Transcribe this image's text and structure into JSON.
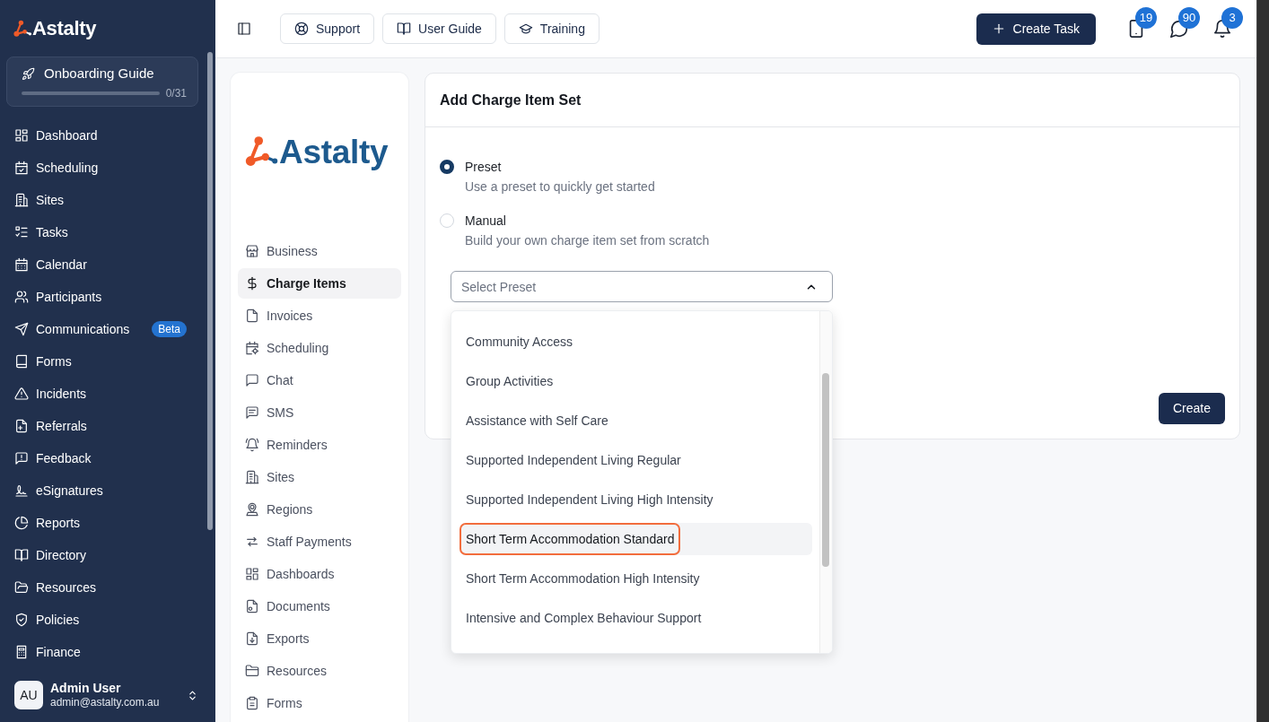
{
  "sidebar": {
    "logo_text": "Astalty",
    "onboarding": {
      "title": "Onboarding Guide",
      "level": 0,
      "count": "0/31"
    },
    "items": [
      {
        "label": "Dashboard",
        "selected": false
      },
      {
        "label": "Scheduling",
        "selected": false
      },
      {
        "label": "Sites",
        "selected": false
      },
      {
        "label": "Tasks",
        "selected": false
      },
      {
        "label": "Calendar",
        "selected": false
      },
      {
        "label": "Participants",
        "selected": false
      },
      {
        "label": "Communications",
        "selected": false,
        "badge": "Beta"
      },
      {
        "label": "Forms",
        "selected": false
      },
      {
        "label": "Incidents",
        "selected": false
      },
      {
        "label": "Referrals",
        "selected": false
      },
      {
        "label": "Feedback",
        "selected": false
      },
      {
        "label": "eSignatures",
        "selected": false
      },
      {
        "label": "Reports",
        "selected": false
      },
      {
        "label": "Directory",
        "selected": false
      },
      {
        "label": "Resources",
        "selected": false
      },
      {
        "label": "Policies",
        "selected": false
      },
      {
        "label": "Finance",
        "selected": false
      }
    ],
    "user": {
      "initials": "AU",
      "name": "Admin User",
      "email": "admin@astalty.com.au"
    }
  },
  "topbar": {
    "links": [
      {
        "label": "Support"
      },
      {
        "label": "User Guide"
      },
      {
        "label": "Training"
      }
    ],
    "create_button": "Create Task",
    "notifications": [
      {
        "count": "19"
      },
      {
        "count": "90"
      },
      {
        "count": "3"
      }
    ]
  },
  "settings_nav": {
    "logo_text": "Astalty",
    "items": [
      {
        "label": "Business",
        "selected": false
      },
      {
        "label": "Charge Items",
        "selected": true
      },
      {
        "label": "Invoices",
        "selected": false
      },
      {
        "label": "Scheduling",
        "selected": false
      },
      {
        "label": "Chat",
        "selected": false
      },
      {
        "label": "SMS",
        "selected": false
      },
      {
        "label": "Reminders",
        "selected": false
      },
      {
        "label": "Sites",
        "selected": false
      },
      {
        "label": "Regions",
        "selected": false
      },
      {
        "label": "Staff Payments",
        "selected": false
      },
      {
        "label": "Dashboards",
        "selected": false
      },
      {
        "label": "Documents",
        "selected": false
      },
      {
        "label": "Exports",
        "selected": false
      },
      {
        "label": "Resources",
        "selected": false
      },
      {
        "label": "Forms",
        "selected": false
      }
    ]
  },
  "form": {
    "title": "Add Charge Item Set",
    "options": [
      {
        "label": "Preset",
        "description": "Use a preset to quickly get started",
        "selected": true
      },
      {
        "label": "Manual",
        "description": "Build your own charge item set from scratch",
        "selected": false
      }
    ],
    "preset_select": {
      "placeholder": "Select Preset",
      "expanded": true,
      "options": [
        {
          "label": "Community Access",
          "hovered": false,
          "outlined": false
        },
        {
          "label": "Group Activities",
          "hovered": false,
          "outlined": false
        },
        {
          "label": "Assistance with Self Care",
          "hovered": false,
          "outlined": false
        },
        {
          "label": "Supported Independent Living Regular",
          "hovered": false,
          "outlined": false
        },
        {
          "label": "Supported Independent Living High Intensity",
          "hovered": false,
          "outlined": false
        },
        {
          "label": "Short Term Accommodation Standard",
          "hovered": true,
          "outlined": true
        },
        {
          "label": "Short Term Accommodation High Intensity",
          "hovered": false,
          "outlined": false
        },
        {
          "label": "Intensive and Complex Behaviour Support",
          "hovered": false,
          "outlined": false
        }
      ]
    },
    "submit": "Create"
  }
}
